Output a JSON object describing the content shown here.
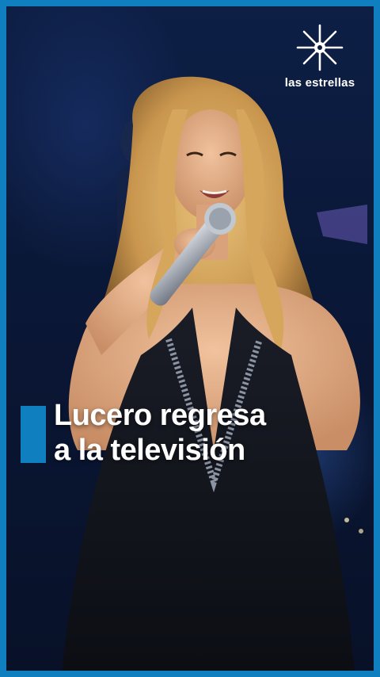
{
  "brand": {
    "logo_icon": "star-burst-icon",
    "name": "las estrellas",
    "accent_color": "#0f7fc0"
  },
  "headline": {
    "line1": "Lucero regresa",
    "line2": "a la televisión"
  }
}
